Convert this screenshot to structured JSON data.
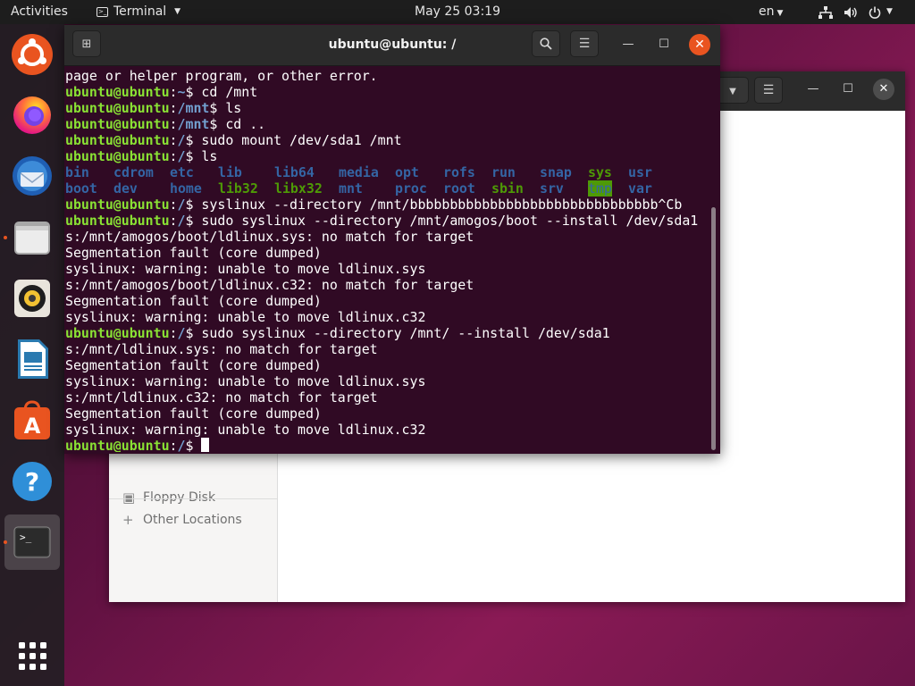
{
  "topbar": {
    "activities": "Activities",
    "app_name": "Terminal",
    "datetime": "May 25  03:19",
    "lang": "en"
  },
  "dock": {
    "apps": [
      {
        "name": "Ubuntu Software Center",
        "icon": "ubuntu-logo-icon"
      },
      {
        "name": "Firefox",
        "icon": "firefox-icon"
      },
      {
        "name": "Thunderbird",
        "icon": "thunderbird-icon"
      },
      {
        "name": "Files",
        "icon": "files-folder-icon",
        "running": true
      },
      {
        "name": "Rhythmbox",
        "icon": "rhythmbox-speaker-icon"
      },
      {
        "name": "LibreOffice Writer",
        "icon": "libreoffice-writer-icon"
      },
      {
        "name": "Ubuntu Software",
        "icon": "software-store-icon"
      },
      {
        "name": "Help",
        "icon": "help-icon"
      },
      {
        "name": "Terminal",
        "icon": "terminal-icon",
        "running": true,
        "active": true
      }
    ],
    "show_apps": "grid-icon"
  },
  "files_window": {
    "sidebar": [
      {
        "label": "Floppy Disk",
        "icon": "floppy-disk-icon"
      },
      {
        "label": "Other Locations",
        "icon": "plus-icon"
      }
    ]
  },
  "terminal": {
    "title": "ubuntu@ubuntu: /",
    "user_host": "ubuntu@ubuntu",
    "lines": [
      {
        "t": "text",
        "text": "page or helper program, or other error."
      },
      {
        "t": "cmd",
        "path": "~",
        "cmd": " cd /mnt"
      },
      {
        "t": "cmd",
        "path": "/mnt",
        "cmd": " ls"
      },
      {
        "t": "cmd",
        "path": "/mnt",
        "cmd": " cd .."
      },
      {
        "t": "cmd",
        "path": "/",
        "cmd": " sudo mount /dev/sda1 /mnt"
      },
      {
        "t": "cmd",
        "path": "/",
        "cmd": " ls"
      },
      {
        "t": "ls",
        "items": [
          {
            "n": "bin",
            "k": "dir"
          },
          {
            "n": "cdrom",
            "k": "dir"
          },
          {
            "n": "etc",
            "k": "dir"
          },
          {
            "n": "lib",
            "k": "dir"
          },
          {
            "n": "lib64",
            "k": "dir"
          },
          {
            "n": "media",
            "k": "dir"
          },
          {
            "n": "opt",
            "k": "dir"
          },
          {
            "n": "rofs",
            "k": "dir"
          },
          {
            "n": "run",
            "k": "dir"
          },
          {
            "n": "snap",
            "k": "dir"
          },
          {
            "n": "sys",
            "k": "exe"
          },
          {
            "n": "usr",
            "k": "dir"
          }
        ]
      },
      {
        "t": "ls",
        "items": [
          {
            "n": "boot",
            "k": "dir"
          },
          {
            "n": "dev",
            "k": "dir"
          },
          {
            "n": "home",
            "k": "dir"
          },
          {
            "n": "lib32",
            "k": "exe"
          },
          {
            "n": "libx32",
            "k": "exe"
          },
          {
            "n": "mnt",
            "k": "dir"
          },
          {
            "n": "proc",
            "k": "dir"
          },
          {
            "n": "root",
            "k": "dir"
          },
          {
            "n": "sbin",
            "k": "exe"
          },
          {
            "n": "srv",
            "k": "dir"
          },
          {
            "n": "tmp",
            "k": "sticky"
          },
          {
            "n": "var",
            "k": "dir"
          }
        ]
      },
      {
        "t": "cmd",
        "path": "/",
        "cmd": " syslinux --directory /mnt/bbbbbbbbbbbbbbbbbbbbbbbbbbbbbbb^Cb"
      },
      {
        "t": "cmd",
        "path": "/",
        "cmd": " sudo syslinux --directory /mnt/amogos/boot --install /dev/sda1"
      },
      {
        "t": "text",
        "text": "s:/mnt/amogos/boot/ldlinux.sys: no match for target"
      },
      {
        "t": "text",
        "text": "Segmentation fault (core dumped)"
      },
      {
        "t": "text",
        "text": "syslinux: warning: unable to move ldlinux.sys"
      },
      {
        "t": "text",
        "text": "s:/mnt/amogos/boot/ldlinux.c32: no match for target"
      },
      {
        "t": "text",
        "text": "Segmentation fault (core dumped)"
      },
      {
        "t": "text",
        "text": "syslinux: warning: unable to move ldlinux.c32"
      },
      {
        "t": "cmd",
        "path": "/",
        "cmd": " sudo syslinux --directory /mnt/ --install /dev/sda1"
      },
      {
        "t": "text",
        "text": "s:/mnt/ldlinux.sys: no match for target"
      },
      {
        "t": "text",
        "text": "Segmentation fault (core dumped)"
      },
      {
        "t": "text",
        "text": "syslinux: warning: unable to move ldlinux.sys"
      },
      {
        "t": "text",
        "text": "s:/mnt/ldlinux.c32: no match for target"
      },
      {
        "t": "text",
        "text": "Segmentation fault (core dumped)"
      },
      {
        "t": "text",
        "text": "syslinux: warning: unable to move ldlinux.c32"
      },
      {
        "t": "prompt",
        "path": "/",
        "cmd": " "
      }
    ]
  },
  "colors": {
    "terminal_bg": "#300a24",
    "prompt_user": "#8ae234",
    "prompt_path": "#729fcf",
    "ls_dir": "#3465a4",
    "ls_exe": "#4e9a06",
    "accent_orange": "#e95420"
  }
}
